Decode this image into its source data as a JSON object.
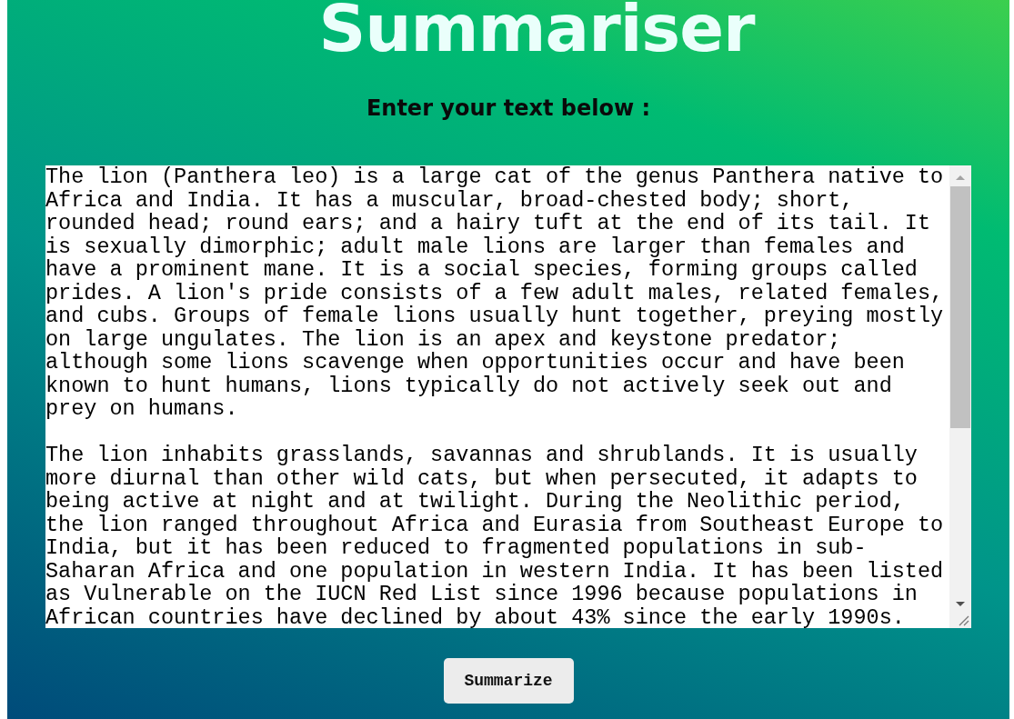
{
  "title": "Summariser",
  "prompt": "Enter your text below :",
  "text_input": {
    "paragraphs": [
      "The lion (Panthera leo) is a large cat of the genus Panthera native to Africa and India. It has a muscular, broad-chested body; short, rounded head; round ears; and a hairy tuft at the end of its tail. It is sexually dimorphic; adult male lions are larger than females and have a prominent mane. It is a social species, forming groups called prides. A lion's pride consists of a few adult males, related females, and cubs. Groups of female lions usually hunt together, preying mostly on large ungulates. The lion is an apex and keystone predator; although some lions scavenge when opportunities occur and have been known to hunt humans, lions typically do not actively seek out and prey on humans.",
      "The lion inhabits grasslands, savannas and shrublands. It is usually more diurnal than other wild cats, but when persecuted, it adapts to being active at night and at twilight. During the Neolithic period, the lion ranged throughout Africa and Eurasia from Southeast Europe to India, but it has been reduced to fragmented populations in sub-Saharan Africa and one population in western India. It has been listed as Vulnerable on the IUCN Red List since 1996 because populations in African countries have declined by about 43% since the early 1990s."
    ]
  },
  "buttons": [
    "Summarize"
  ]
}
